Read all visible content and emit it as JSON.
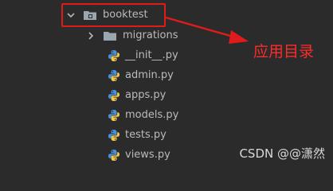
{
  "project_tree": {
    "app_folder": {
      "name": "booktest",
      "expanded": true,
      "icon": "folder-icon"
    },
    "children": [
      {
        "name": "migrations",
        "type": "folder",
        "expanded": false,
        "icon": "folder-icon"
      },
      {
        "name": "__init__.py",
        "type": "python-file",
        "icon": "python-file-icon"
      },
      {
        "name": "admin.py",
        "type": "python-file",
        "icon": "python-file-icon"
      },
      {
        "name": "apps.py",
        "type": "python-file",
        "icon": "python-file-icon"
      },
      {
        "name": "models.py",
        "type": "python-file",
        "icon": "python-file-icon"
      },
      {
        "name": "tests.py",
        "type": "python-file",
        "icon": "python-file-icon"
      },
      {
        "name": "views.py",
        "type": "python-file",
        "icon": "python-file-icon"
      }
    ]
  },
  "annotation": {
    "text": "应用目录",
    "color": "#ff2a2a"
  },
  "watermark": "CSDN @@潇然",
  "colors": {
    "background": "#2b2b2b",
    "tree_text": "#bbbbbb",
    "folder": "#9aa7b0",
    "python_blue": "#4a90d9",
    "python_yellow": "#f2c94c",
    "highlight_border": "#e01b1b"
  }
}
